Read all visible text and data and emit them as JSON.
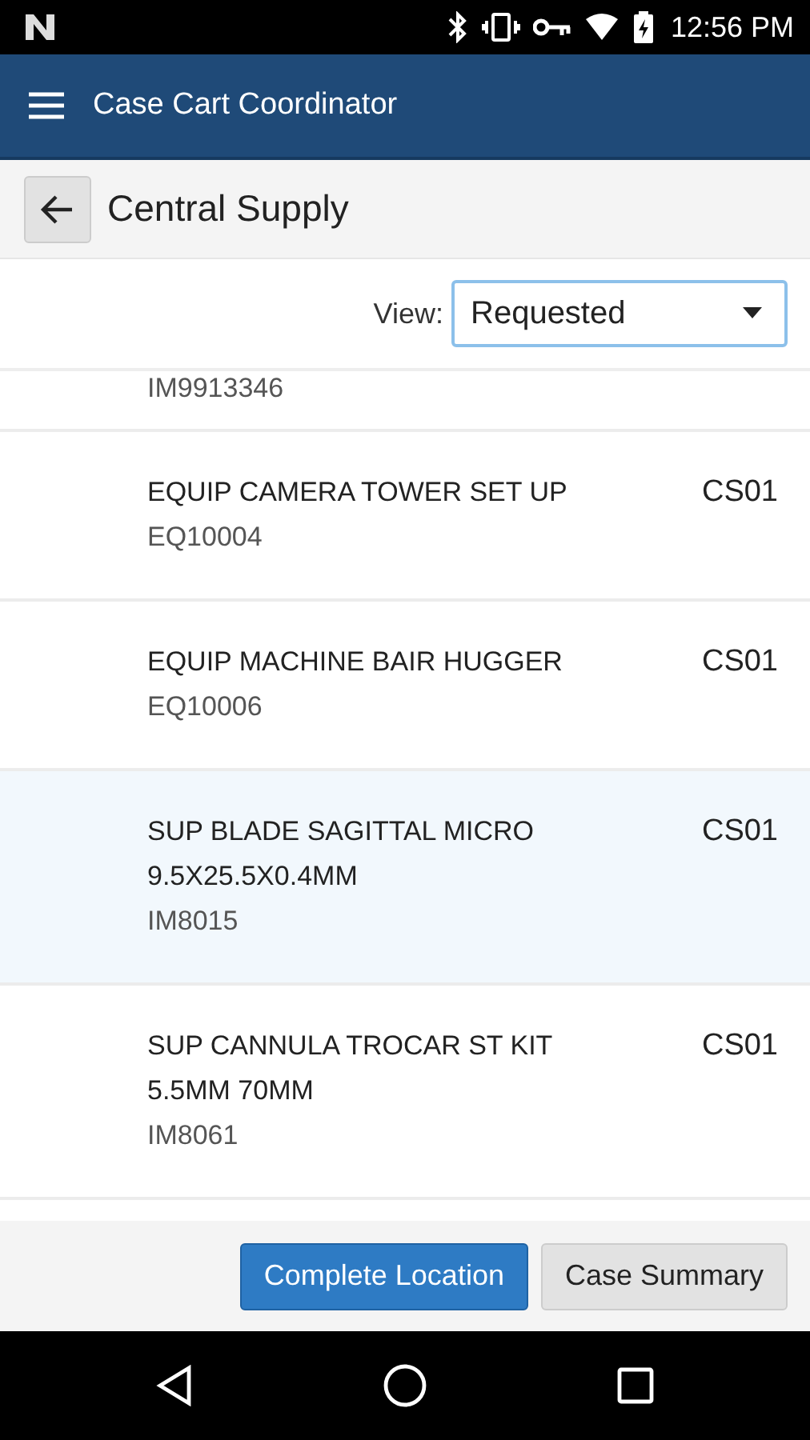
{
  "status_bar": {
    "time": "12:56 PM"
  },
  "app_bar": {
    "title": "Case Cart Coordinator"
  },
  "header": {
    "title": "Central Supply"
  },
  "view_filter": {
    "label": "View:",
    "value": "Requested"
  },
  "items": [
    {
      "code": "IM9913346",
      "selected": false
    },
    {
      "name": "EQUIP CAMERA TOWER SET UP",
      "code": "EQ10004",
      "location": "CS01",
      "selected": false
    },
    {
      "name": "EQUIP MACHINE BAIR HUGGER",
      "code": "EQ10006",
      "location": "CS01",
      "selected": false
    },
    {
      "name": "SUP BLADE SAGITTAL MICRO 9.5X25.5X0.4MM",
      "code": "IM8015",
      "location": "CS01",
      "selected": true
    },
    {
      "name": "SUP CANNULA TROCAR ST KIT 5.5MM 70MM",
      "code": "IM8061",
      "location": "CS01",
      "selected": false
    }
  ],
  "buttons": [
    {
      "label": "Complete Location",
      "kind": "primary"
    },
    {
      "label": "Case Summary",
      "kind": "secondary"
    }
  ]
}
